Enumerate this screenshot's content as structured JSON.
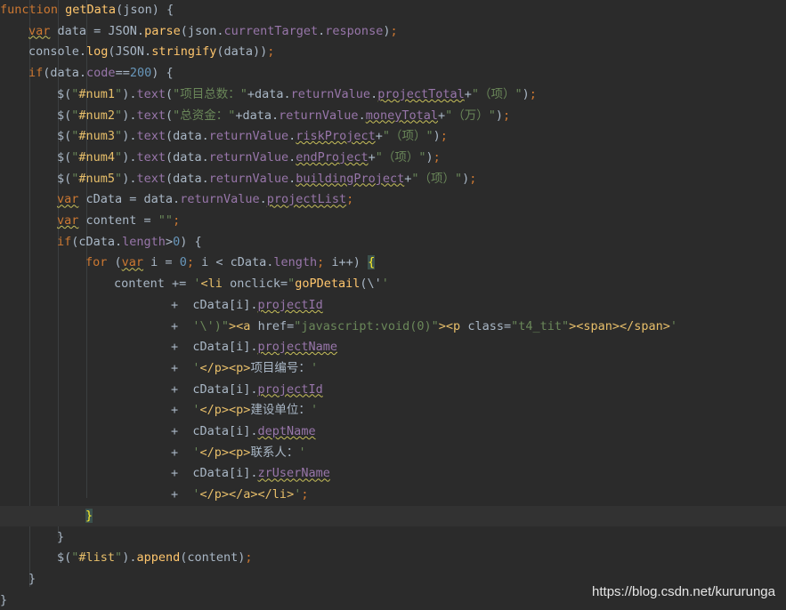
{
  "editor": {
    "colors": {
      "background": "#2b2b2b",
      "current_line": "#323232",
      "keyword": "#cc7832",
      "function": "#ffc66d",
      "string": "#6a8759",
      "number": "#6897bb",
      "property": "#9876aa",
      "plain": "#a9b7c6"
    },
    "lines": [
      {
        "indent": 0,
        "tokens": [
          [
            "kw",
            "function "
          ],
          [
            "fn",
            "getData"
          ],
          [
            "txt",
            "(json) {"
          ]
        ]
      },
      {
        "indent": 1,
        "tokens": [
          [
            "kw sq",
            "var"
          ],
          [
            "txt",
            " data = JSON."
          ],
          [
            "fn",
            "parse"
          ],
          [
            "txt",
            "(json."
          ],
          [
            "prop",
            "currentTarget"
          ],
          [
            "txt",
            "."
          ],
          [
            "prop",
            "response"
          ],
          [
            "txt",
            ")"
          ],
          [
            "kw",
            ";"
          ]
        ]
      },
      {
        "indent": 1,
        "tokens": [
          [
            "txt",
            "console."
          ],
          [
            "fn",
            "log"
          ],
          [
            "txt",
            "(JSON."
          ],
          [
            "fn",
            "stringify"
          ],
          [
            "txt",
            "(data))"
          ],
          [
            "kw",
            ";"
          ]
        ]
      },
      {
        "indent": 1,
        "tokens": [
          [
            "kw",
            "if"
          ],
          [
            "txt",
            "(data."
          ],
          [
            "prop",
            "code"
          ],
          [
            "txt",
            "=="
          ],
          [
            "num",
            "200"
          ],
          [
            "txt",
            ") {"
          ]
        ]
      },
      {
        "indent": 2,
        "tokens": [
          [
            "txt",
            "$("
          ],
          [
            "str",
            "\""
          ],
          [
            "sel",
            "#num1"
          ],
          [
            "str",
            "\""
          ],
          [
            "txt",
            ")."
          ],
          [
            "prop",
            "text"
          ],
          [
            "txt",
            "("
          ],
          [
            "str",
            "\"项目总数：\""
          ],
          [
            "txt",
            "+data."
          ],
          [
            "prop",
            "returnValue"
          ],
          [
            "txt",
            "."
          ],
          [
            "prop sq",
            "projectTotal"
          ],
          [
            "txt",
            "+"
          ],
          [
            "str",
            "\"（项）\""
          ],
          [
            "txt",
            ")"
          ],
          [
            "kw",
            ";"
          ]
        ]
      },
      {
        "indent": 2,
        "tokens": [
          [
            "txt",
            "$("
          ],
          [
            "str",
            "\""
          ],
          [
            "sel",
            "#num2"
          ],
          [
            "str",
            "\""
          ],
          [
            "txt",
            ")."
          ],
          [
            "prop",
            "text"
          ],
          [
            "txt",
            "("
          ],
          [
            "str",
            "\"总资金：\""
          ],
          [
            "txt",
            "+data."
          ],
          [
            "prop",
            "returnValue"
          ],
          [
            "txt",
            "."
          ],
          [
            "prop sq",
            "moneyTotal"
          ],
          [
            "txt",
            "+"
          ],
          [
            "str",
            "\"（万）\""
          ],
          [
            "txt",
            ")"
          ],
          [
            "kw",
            ";"
          ]
        ]
      },
      {
        "indent": 2,
        "tokens": [
          [
            "txt",
            "$("
          ],
          [
            "str",
            "\""
          ],
          [
            "sel",
            "#num3"
          ],
          [
            "str",
            "\""
          ],
          [
            "txt",
            ")."
          ],
          [
            "prop",
            "text"
          ],
          [
            "txt",
            "(data."
          ],
          [
            "prop",
            "returnValue"
          ],
          [
            "txt",
            "."
          ],
          [
            "prop sq",
            "riskProject"
          ],
          [
            "txt",
            "+"
          ],
          [
            "str",
            "\"（项）\""
          ],
          [
            "txt",
            ")"
          ],
          [
            "kw",
            ";"
          ]
        ]
      },
      {
        "indent": 2,
        "tokens": [
          [
            "txt",
            "$("
          ],
          [
            "str",
            "\""
          ],
          [
            "sel",
            "#num4"
          ],
          [
            "str",
            "\""
          ],
          [
            "txt",
            ")."
          ],
          [
            "prop",
            "text"
          ],
          [
            "txt",
            "(data."
          ],
          [
            "prop",
            "returnValue"
          ],
          [
            "txt",
            "."
          ],
          [
            "prop sq",
            "endProject"
          ],
          [
            "txt",
            "+"
          ],
          [
            "str",
            "\"（项）\""
          ],
          [
            "txt",
            ")"
          ],
          [
            "kw",
            ";"
          ]
        ]
      },
      {
        "indent": 2,
        "tokens": [
          [
            "txt",
            "$("
          ],
          [
            "str",
            "\""
          ],
          [
            "sel",
            "#num5"
          ],
          [
            "str",
            "\""
          ],
          [
            "txt",
            ")."
          ],
          [
            "prop",
            "text"
          ],
          [
            "txt",
            "(data."
          ],
          [
            "prop",
            "returnValue"
          ],
          [
            "txt",
            "."
          ],
          [
            "prop sq",
            "buildingProject"
          ],
          [
            "txt",
            "+"
          ],
          [
            "str",
            "\"（项）\""
          ],
          [
            "txt",
            ")"
          ],
          [
            "kw",
            ";"
          ]
        ]
      },
      {
        "indent": 2,
        "tokens": [
          [
            "kw sq",
            "var"
          ],
          [
            "txt",
            " cData = data."
          ],
          [
            "prop",
            "returnValue"
          ],
          [
            "txt",
            "."
          ],
          [
            "prop sq",
            "projectList"
          ],
          [
            "kw",
            ";"
          ]
        ]
      },
      {
        "indent": 2,
        "tokens": [
          [
            "kw sq",
            "var"
          ],
          [
            "txt",
            " content = "
          ],
          [
            "str",
            "\"\""
          ],
          [
            "kw",
            ";"
          ]
        ]
      },
      {
        "indent": 2,
        "tokens": [
          [
            "kw",
            "if"
          ],
          [
            "txt",
            "(cData."
          ],
          [
            "prop",
            "length"
          ],
          [
            "txt",
            ">"
          ],
          [
            "num",
            "0"
          ],
          [
            "txt",
            ") {"
          ]
        ]
      },
      {
        "indent": 3,
        "tokens": [
          [
            "kw",
            "for "
          ],
          [
            "txt",
            "("
          ],
          [
            "kw sq",
            "var"
          ],
          [
            "txt",
            " i = "
          ],
          [
            "num",
            "0"
          ],
          [
            "kw",
            "; "
          ],
          [
            "txt",
            "i < cData."
          ],
          [
            "prop",
            "length"
          ],
          [
            "kw",
            "; "
          ],
          [
            "txt",
            "i++) "
          ],
          [
            "brace-match",
            "{"
          ]
        ]
      },
      {
        "indent": 4,
        "tokens": [
          [
            "txt",
            "content += "
          ],
          [
            "str",
            "'"
          ],
          [
            "sel",
            "<li"
          ],
          [
            "txt",
            " onclick="
          ],
          [
            "str",
            "\""
          ],
          [
            "fn",
            "goPDetail"
          ],
          [
            "txt",
            "(\\'"
          ],
          [
            "str",
            "'"
          ]
        ]
      },
      {
        "indent": 6,
        "tokens": [
          [
            "txt",
            "+  cData[i]."
          ],
          [
            "prop sq",
            "projectId"
          ]
        ]
      },
      {
        "indent": 6,
        "tokens": [
          [
            "txt",
            "+  "
          ],
          [
            "str",
            "'\\')\""
          ],
          [
            "sel",
            ">"
          ],
          [
            "sel",
            "<a"
          ],
          [
            "txt",
            " href="
          ],
          [
            "str",
            "\"javascript:void(0)\""
          ],
          [
            "sel",
            ">"
          ],
          [
            "sel",
            "<p"
          ],
          [
            "txt",
            " class="
          ],
          [
            "str",
            "\"t4_tit\""
          ],
          [
            "sel",
            "><span></span>"
          ],
          [
            "str",
            "'"
          ]
        ]
      },
      {
        "indent": 6,
        "tokens": [
          [
            "txt",
            "+  cData[i]."
          ],
          [
            "prop sq",
            "projectName"
          ]
        ]
      },
      {
        "indent": 6,
        "tokens": [
          [
            "txt",
            "+  "
          ],
          [
            "str",
            "'"
          ],
          [
            "sel",
            "</p><p>"
          ],
          [
            "txt",
            "项目编号："
          ],
          [
            "str",
            "'"
          ]
        ]
      },
      {
        "indent": 6,
        "tokens": [
          [
            "txt",
            "+  cData[i]."
          ],
          [
            "prop sq",
            "projectId"
          ]
        ]
      },
      {
        "indent": 6,
        "tokens": [
          [
            "txt",
            "+  "
          ],
          [
            "str",
            "'"
          ],
          [
            "sel",
            "</p><p>"
          ],
          [
            "txt",
            "建设单位："
          ],
          [
            "str",
            "'"
          ]
        ]
      },
      {
        "indent": 6,
        "tokens": [
          [
            "txt",
            "+  cData[i]."
          ],
          [
            "prop sq",
            "deptName"
          ]
        ]
      },
      {
        "indent": 6,
        "tokens": [
          [
            "txt",
            "+  "
          ],
          [
            "str",
            "'"
          ],
          [
            "sel",
            "</p><p>"
          ],
          [
            "txt",
            "联系人："
          ],
          [
            "str",
            "'"
          ]
        ]
      },
      {
        "indent": 6,
        "tokens": [
          [
            "txt",
            "+  cData[i]."
          ],
          [
            "prop sq",
            "zrUserName"
          ]
        ]
      },
      {
        "indent": 6,
        "tokens": [
          [
            "txt",
            "+  "
          ],
          [
            "str",
            "'"
          ],
          [
            "sel",
            "</p></a></li>"
          ],
          [
            "str",
            "'"
          ],
          [
            "kw",
            ";"
          ]
        ]
      },
      {
        "indent": 3,
        "current": true,
        "tokens": [
          [
            "brace-match",
            "}"
          ]
        ]
      },
      {
        "indent": 2,
        "tokens": [
          [
            "txt",
            "}"
          ]
        ]
      },
      {
        "indent": 2,
        "tokens": [
          [
            "txt",
            "$("
          ],
          [
            "str",
            "\""
          ],
          [
            "sel",
            "#list"
          ],
          [
            "str",
            "\""
          ],
          [
            "txt",
            ")."
          ],
          [
            "fn",
            "append"
          ],
          [
            "txt",
            "(content)"
          ],
          [
            "kw",
            ";"
          ]
        ]
      },
      {
        "indent": 1,
        "tokens": [
          [
            "txt",
            "}"
          ]
        ]
      },
      {
        "indent": 0,
        "tokens": [
          [
            "txt",
            "}"
          ]
        ]
      }
    ]
  },
  "watermark": "https://blog.csdn.net/kururunga"
}
